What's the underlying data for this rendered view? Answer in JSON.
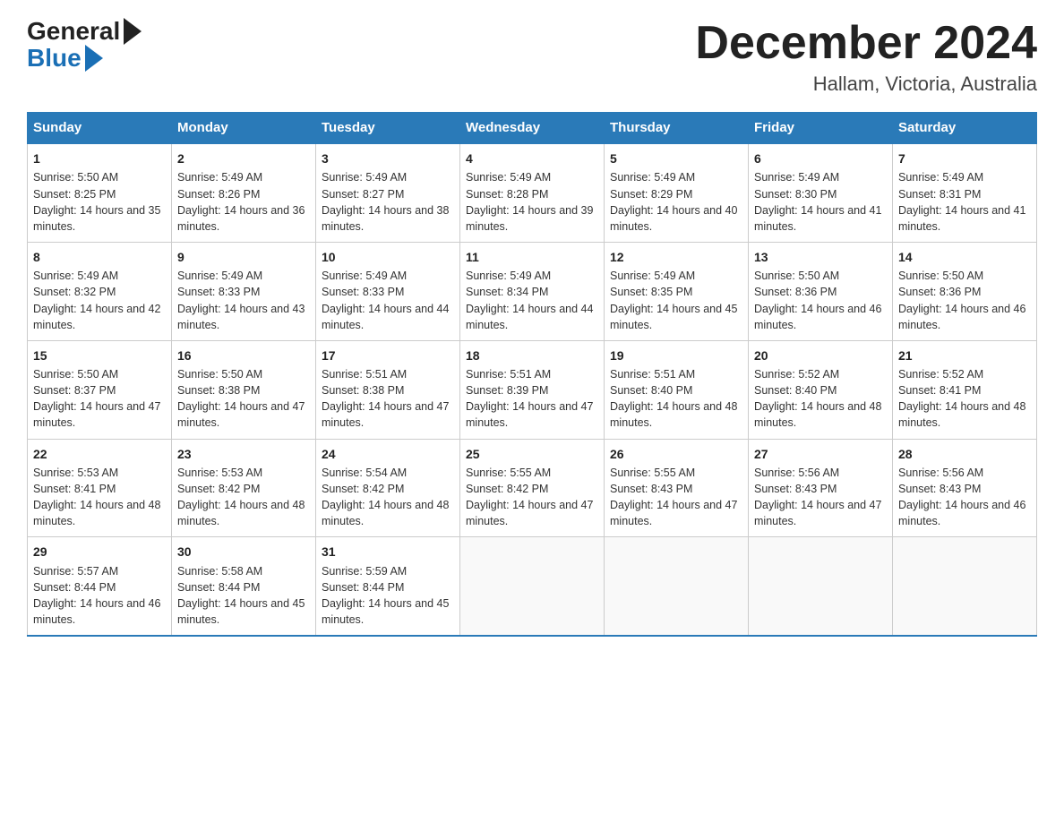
{
  "logo": {
    "general": "General",
    "blue": "Blue"
  },
  "title": "December 2024",
  "location": "Hallam, Victoria, Australia",
  "days_of_week": [
    "Sunday",
    "Monday",
    "Tuesday",
    "Wednesday",
    "Thursday",
    "Friday",
    "Saturday"
  ],
  "weeks": [
    [
      {
        "day": "1",
        "sunrise": "Sunrise: 5:50 AM",
        "sunset": "Sunset: 8:25 PM",
        "daylight": "Daylight: 14 hours and 35 minutes."
      },
      {
        "day": "2",
        "sunrise": "Sunrise: 5:49 AM",
        "sunset": "Sunset: 8:26 PM",
        "daylight": "Daylight: 14 hours and 36 minutes."
      },
      {
        "day": "3",
        "sunrise": "Sunrise: 5:49 AM",
        "sunset": "Sunset: 8:27 PM",
        "daylight": "Daylight: 14 hours and 38 minutes."
      },
      {
        "day": "4",
        "sunrise": "Sunrise: 5:49 AM",
        "sunset": "Sunset: 8:28 PM",
        "daylight": "Daylight: 14 hours and 39 minutes."
      },
      {
        "day": "5",
        "sunrise": "Sunrise: 5:49 AM",
        "sunset": "Sunset: 8:29 PM",
        "daylight": "Daylight: 14 hours and 40 minutes."
      },
      {
        "day": "6",
        "sunrise": "Sunrise: 5:49 AM",
        "sunset": "Sunset: 8:30 PM",
        "daylight": "Daylight: 14 hours and 41 minutes."
      },
      {
        "day": "7",
        "sunrise": "Sunrise: 5:49 AM",
        "sunset": "Sunset: 8:31 PM",
        "daylight": "Daylight: 14 hours and 41 minutes."
      }
    ],
    [
      {
        "day": "8",
        "sunrise": "Sunrise: 5:49 AM",
        "sunset": "Sunset: 8:32 PM",
        "daylight": "Daylight: 14 hours and 42 minutes."
      },
      {
        "day": "9",
        "sunrise": "Sunrise: 5:49 AM",
        "sunset": "Sunset: 8:33 PM",
        "daylight": "Daylight: 14 hours and 43 minutes."
      },
      {
        "day": "10",
        "sunrise": "Sunrise: 5:49 AM",
        "sunset": "Sunset: 8:33 PM",
        "daylight": "Daylight: 14 hours and 44 minutes."
      },
      {
        "day": "11",
        "sunrise": "Sunrise: 5:49 AM",
        "sunset": "Sunset: 8:34 PM",
        "daylight": "Daylight: 14 hours and 44 minutes."
      },
      {
        "day": "12",
        "sunrise": "Sunrise: 5:49 AM",
        "sunset": "Sunset: 8:35 PM",
        "daylight": "Daylight: 14 hours and 45 minutes."
      },
      {
        "day": "13",
        "sunrise": "Sunrise: 5:50 AM",
        "sunset": "Sunset: 8:36 PM",
        "daylight": "Daylight: 14 hours and 46 minutes."
      },
      {
        "day": "14",
        "sunrise": "Sunrise: 5:50 AM",
        "sunset": "Sunset: 8:36 PM",
        "daylight": "Daylight: 14 hours and 46 minutes."
      }
    ],
    [
      {
        "day": "15",
        "sunrise": "Sunrise: 5:50 AM",
        "sunset": "Sunset: 8:37 PM",
        "daylight": "Daylight: 14 hours and 47 minutes."
      },
      {
        "day": "16",
        "sunrise": "Sunrise: 5:50 AM",
        "sunset": "Sunset: 8:38 PM",
        "daylight": "Daylight: 14 hours and 47 minutes."
      },
      {
        "day": "17",
        "sunrise": "Sunrise: 5:51 AM",
        "sunset": "Sunset: 8:38 PM",
        "daylight": "Daylight: 14 hours and 47 minutes."
      },
      {
        "day": "18",
        "sunrise": "Sunrise: 5:51 AM",
        "sunset": "Sunset: 8:39 PM",
        "daylight": "Daylight: 14 hours and 47 minutes."
      },
      {
        "day": "19",
        "sunrise": "Sunrise: 5:51 AM",
        "sunset": "Sunset: 8:40 PM",
        "daylight": "Daylight: 14 hours and 48 minutes."
      },
      {
        "day": "20",
        "sunrise": "Sunrise: 5:52 AM",
        "sunset": "Sunset: 8:40 PM",
        "daylight": "Daylight: 14 hours and 48 minutes."
      },
      {
        "day": "21",
        "sunrise": "Sunrise: 5:52 AM",
        "sunset": "Sunset: 8:41 PM",
        "daylight": "Daylight: 14 hours and 48 minutes."
      }
    ],
    [
      {
        "day": "22",
        "sunrise": "Sunrise: 5:53 AM",
        "sunset": "Sunset: 8:41 PM",
        "daylight": "Daylight: 14 hours and 48 minutes."
      },
      {
        "day": "23",
        "sunrise": "Sunrise: 5:53 AM",
        "sunset": "Sunset: 8:42 PM",
        "daylight": "Daylight: 14 hours and 48 minutes."
      },
      {
        "day": "24",
        "sunrise": "Sunrise: 5:54 AM",
        "sunset": "Sunset: 8:42 PM",
        "daylight": "Daylight: 14 hours and 48 minutes."
      },
      {
        "day": "25",
        "sunrise": "Sunrise: 5:55 AM",
        "sunset": "Sunset: 8:42 PM",
        "daylight": "Daylight: 14 hours and 47 minutes."
      },
      {
        "day": "26",
        "sunrise": "Sunrise: 5:55 AM",
        "sunset": "Sunset: 8:43 PM",
        "daylight": "Daylight: 14 hours and 47 minutes."
      },
      {
        "day": "27",
        "sunrise": "Sunrise: 5:56 AM",
        "sunset": "Sunset: 8:43 PM",
        "daylight": "Daylight: 14 hours and 47 minutes."
      },
      {
        "day": "28",
        "sunrise": "Sunrise: 5:56 AM",
        "sunset": "Sunset: 8:43 PM",
        "daylight": "Daylight: 14 hours and 46 minutes."
      }
    ],
    [
      {
        "day": "29",
        "sunrise": "Sunrise: 5:57 AM",
        "sunset": "Sunset: 8:44 PM",
        "daylight": "Daylight: 14 hours and 46 minutes."
      },
      {
        "day": "30",
        "sunrise": "Sunrise: 5:58 AM",
        "sunset": "Sunset: 8:44 PM",
        "daylight": "Daylight: 14 hours and 45 minutes."
      },
      {
        "day": "31",
        "sunrise": "Sunrise: 5:59 AM",
        "sunset": "Sunset: 8:44 PM",
        "daylight": "Daylight: 14 hours and 45 minutes."
      },
      null,
      null,
      null,
      null
    ]
  ]
}
